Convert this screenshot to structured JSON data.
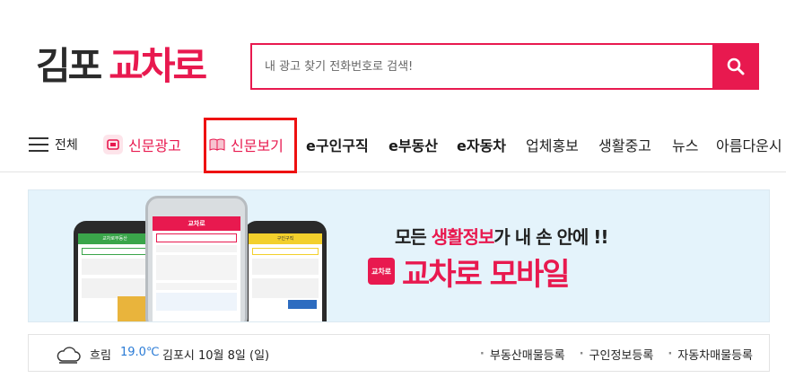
{
  "logo": {
    "part1": "김포",
    "part2": "교차로"
  },
  "search": {
    "placeholder": "내 광고 찾기 전화번호로 검색!",
    "button_icon": "search-icon"
  },
  "nav": {
    "all_label": "전체",
    "items": [
      {
        "label": "신문광고",
        "icon": "newspaper-ad-icon"
      },
      {
        "label": "신문보기",
        "icon": "open-book-icon"
      },
      {
        "label": "e구인구직"
      },
      {
        "label": "e부동산"
      },
      {
        "label": "e자동차"
      },
      {
        "label": "업체홍보"
      },
      {
        "label": "생활중고"
      },
      {
        "label": "뉴스"
      },
      {
        "label": "아름다운시"
      }
    ]
  },
  "banner": {
    "tagline_pre": "모든 ",
    "tagline_hl": "생활정보",
    "tagline_post": "가 내 손 안에 !!",
    "badge": "교차로",
    "title": "교차로 모바일",
    "phone_center_title": "교차로",
    "phone_left_title": "교차로부동산",
    "phone_right_title": "구인구직"
  },
  "weather": {
    "state": "흐림",
    "temp": "19.0℃",
    "location_date": "김포시 10월 8일 (일)"
  },
  "quick_links": [
    "부동산매물등록",
    "구인정보등록",
    "자동차매물등록"
  ],
  "colors": {
    "accent": "#e8194f",
    "temp": "#2a7bd6",
    "highlight_box": "#ee1111"
  }
}
